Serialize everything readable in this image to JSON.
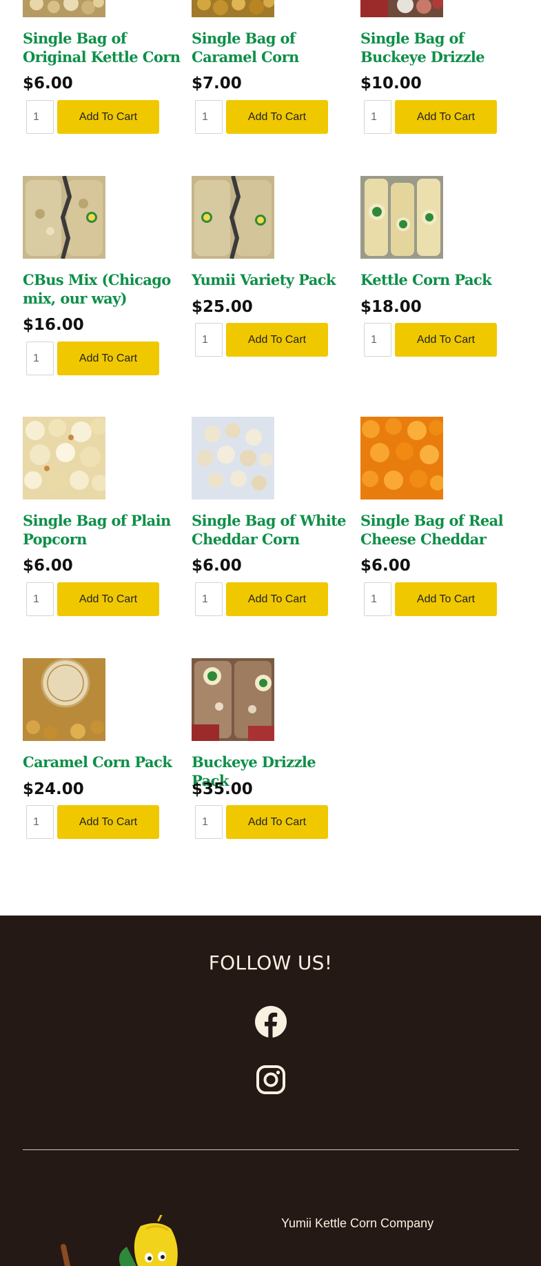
{
  "products": [
    {
      "name": "Single Bag of Original Kettle Corn",
      "price": "$6.00",
      "qty": "1",
      "button": "Add To Cart",
      "image": "kettle-corn-bag-image"
    },
    {
      "name": "Single Bag of Caramel Corn",
      "price": "$7.00",
      "qty": "1",
      "button": "Add To Cart",
      "image": "caramel-corn-bag-image"
    },
    {
      "name": "Single Bag of Buckeye Drizzle",
      "price": "$10.00",
      "qty": "1",
      "button": "Add To Cart",
      "image": "buckeye-drizzle-bag-image"
    },
    {
      "name": "CBus Mix (Chicago mix, our way)",
      "price": "$16.00",
      "qty": "1",
      "button": "Add To Cart",
      "image": "cbus-mix-bags-image"
    },
    {
      "name": "Yumii Variety Pack",
      "price": "$25.00",
      "qty": "1",
      "button": "Add To Cart",
      "image": "variety-pack-bags-image"
    },
    {
      "name": "Kettle Corn Pack",
      "price": "$18.00",
      "qty": "1",
      "button": "Add To Cart",
      "image": "kettle-corn-pack-image"
    },
    {
      "name": "Single Bag of Plain Popcorn",
      "price": "$6.00",
      "qty": "1",
      "button": "Add To Cart",
      "image": "plain-popcorn-image"
    },
    {
      "name": "Single Bag of White Cheddar Corn",
      "price": "$6.00",
      "qty": "1",
      "button": "Add To Cart",
      "image": "white-cheddar-popcorn-image"
    },
    {
      "name": "Single Bag of Real Cheese Cheddar",
      "price": "$6.00",
      "qty": "1",
      "button": "Add To Cart",
      "image": "cheddar-popcorn-image"
    },
    {
      "name": "Caramel Corn Pack",
      "price": "$24.00",
      "qty": "1",
      "button": "Add To Cart",
      "image": "caramel-crunch-pack-image"
    },
    {
      "name": "Buckeye Drizzle Pack",
      "price": "$35.00",
      "qty": "1",
      "button": "Add To Cart",
      "image": "buckeye-drizzle-pack-image"
    }
  ],
  "footer": {
    "follow_heading": "FOLLOW US!",
    "social": [
      {
        "network": "Facebook",
        "icon": "facebook-icon"
      },
      {
        "network": "Instagram",
        "icon": "instagram-icon"
      }
    ],
    "company_name": "Yumii Kettle Corn Company",
    "logo": "corn-mascot-logo"
  },
  "colors": {
    "title_green": "#0e8f48",
    "button_yellow": "#f0c800",
    "footer_bg": "#241915",
    "footer_text": "#f8f1e2"
  }
}
